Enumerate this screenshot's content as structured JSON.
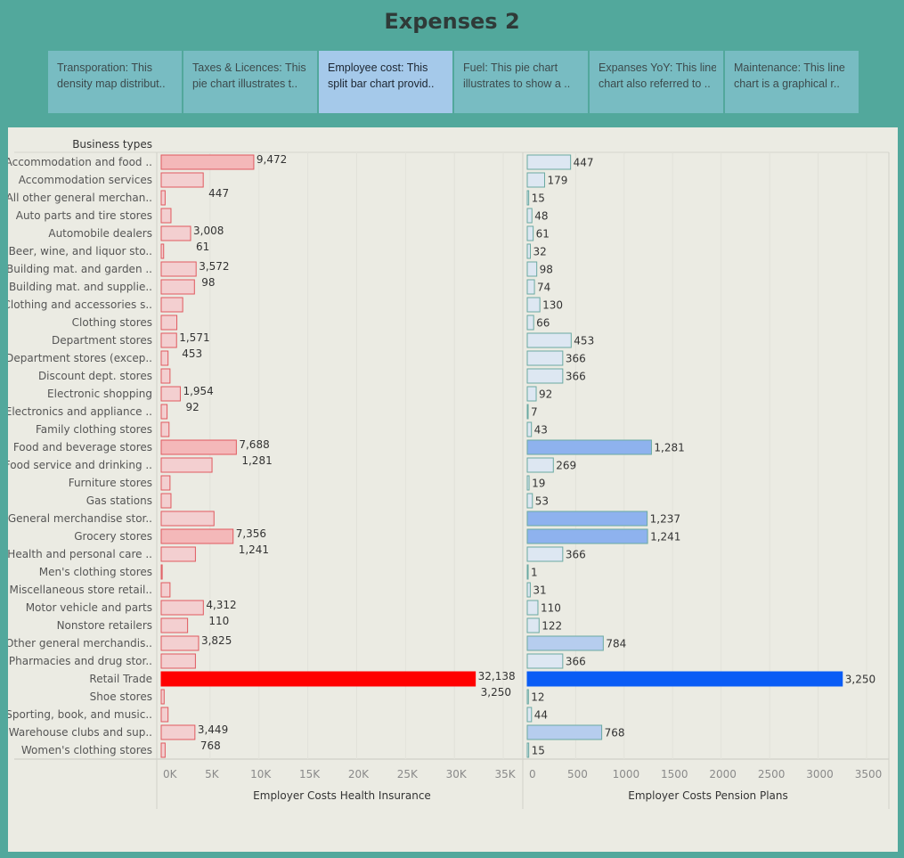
{
  "page": {
    "title": "Expenses 2"
  },
  "tabs": [
    {
      "lines": [
        "Transporation: This",
        "density map distribut.."
      ],
      "active": false
    },
    {
      "lines": [
        "Taxes & Licences:  This",
        "pie chart  illustrates t.."
      ],
      "active": false
    },
    {
      "lines": [
        "Employee cost: This",
        "split bar chart provid.."
      ],
      "active": true
    },
    {
      "lines": [
        "Fuel: This pie chart",
        "illustrates to show a .."
      ],
      "active": false
    },
    {
      "lines": [
        "Expanses YoY: This line",
        "chart also referred to .."
      ],
      "active": false
    },
    {
      "lines": [
        "Maintenance: This line",
        "chart  is a graphical r.."
      ],
      "active": false
    }
  ],
  "chart_data": {
    "type": "bar",
    "orientation": "horizontal",
    "row_header": "Business types",
    "categories": [
      "Accommodation and food ..",
      "Accommodation services",
      "All other general merchan..",
      "Auto parts and tire stores",
      "Automobile dealers",
      "Beer, wine, and liquor sto..",
      "Building mat. and garden ..",
      "Building mat. and supplie..",
      "Clothing and accessories s..",
      "Clothing stores",
      "Department stores",
      "Department stores (excep..",
      "Discount dept. stores",
      "Electronic shopping",
      "Electronics and appliance ..",
      "Family clothing stores",
      "Food and beverage stores",
      "Food service and drinking ..",
      "Furniture stores",
      "Gas stations",
      "General merchandise stor..",
      "Grocery stores",
      "Health and personal care ..",
      "Men's clothing stores",
      "Miscellaneous store retail..",
      "Motor vehicle and parts",
      "Nonstore retailers",
      "Other general merchandis..",
      "Pharmacies and drug stor..",
      "Retail Trade",
      "Shoe stores",
      "Sporting, book, and music..",
      "Warehouse clubs and sup..",
      "Women's clothing stores"
    ],
    "panels": [
      {
        "name": "Employer Costs Health Insurance",
        "xlabel": "Employer Costs Health Insurance",
        "xlim": [
          0,
          37000
        ],
        "ticks": [
          0,
          5000,
          10000,
          15000,
          20000,
          25000,
          30000,
          35000
        ],
        "tick_labels": [
          "0K",
          "5K",
          "10K",
          "15K",
          "20K",
          "25K",
          "30K",
          "35K"
        ],
        "values": [
          9472,
          4300,
          400,
          1000,
          3008,
          250,
          3572,
          3400,
          2200,
          1600,
          1571,
          700,
          900,
          1954,
          600,
          800,
          7688,
          5200,
          900,
          1000,
          5400,
          7356,
          3500,
          100,
          900,
          4312,
          2700,
          3825,
          3500,
          32138,
          300,
          700,
          3449,
          400
        ],
        "data_labels": [
          "9,472",
          "",
          "",
          "",
          "3,008",
          "",
          "3,572",
          "",
          "",
          "",
          "1,571",
          "",
          "",
          "1,954",
          "",
          "",
          "7,688",
          "",
          "",
          "",
          "",
          "7,356",
          "",
          "",
          "",
          "4,312",
          "",
          "3,825",
          "",
          "32,138",
          "",
          "",
          "3,449",
          ""
        ],
        "sub_labels": [
          "",
          "447",
          "",
          "",
          "61",
          "",
          "98",
          "",
          "",
          "",
          "453",
          "",
          "",
          "92",
          "",
          "",
          "1,281",
          "",
          "",
          "",
          "",
          "1,241",
          "",
          "",
          "",
          "110",
          "",
          "",
          "",
          "3,250",
          "",
          "",
          "768",
          ""
        ],
        "sub_label_rows": [
          0,
          4,
          6,
          10,
          13,
          16,
          21,
          25,
          27,
          29,
          32
        ],
        "color_light": "#f3cfd0",
        "color_dark": "#ff0000",
        "stroke": "#e0595f"
      },
      {
        "name": "Employer Costs Pension Plans",
        "xlabel": "Employer Costs Pension Plans",
        "xlim": [
          0,
          3730
        ],
        "ticks": [
          0,
          500,
          1000,
          1500,
          2000,
          2500,
          3000,
          3500
        ],
        "tick_labels": [
          "0",
          "500",
          "1000",
          "1500",
          "2000",
          "2500",
          "3000",
          "3500"
        ],
        "values": [
          447,
          179,
          15,
          48,
          61,
          32,
          98,
          74,
          130,
          66,
          453,
          366,
          366,
          92,
          7,
          43,
          1281,
          269,
          19,
          53,
          1237,
          1241,
          366,
          1,
          31,
          110,
          122,
          784,
          366,
          3250,
          12,
          44,
          768,
          15
        ],
        "data_labels": [
          "447",
          "179",
          "15",
          "48",
          "61",
          "32",
          "98",
          "74",
          "130",
          "66",
          "453",
          "366",
          "366",
          "92",
          "7",
          "43",
          "1,281",
          "269",
          "19",
          "53",
          "1,237",
          "1,241",
          "366",
          "1",
          "31",
          "110",
          "122",
          "784",
          "366",
          "3,250",
          "12",
          "44",
          "768",
          "15"
        ],
        "color_light": "#dde7f2",
        "color_dark": "#0a5cf5",
        "stroke": "#6aa9a2"
      }
    ]
  }
}
